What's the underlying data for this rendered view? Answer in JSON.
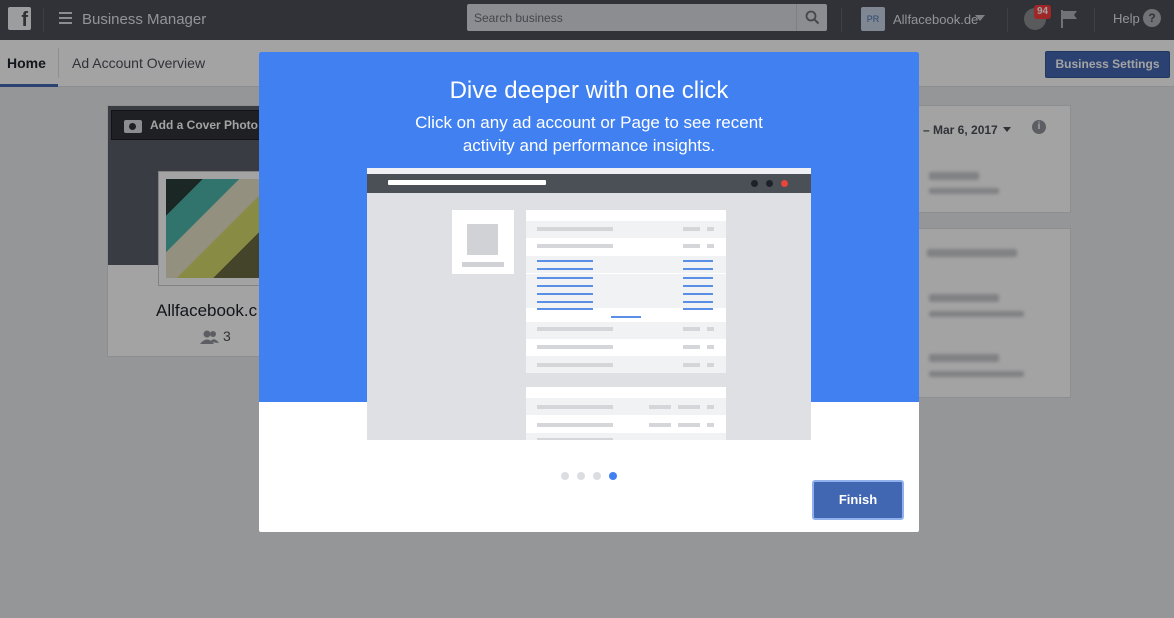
{
  "topbar": {
    "app_title": "Business Manager",
    "search_placeholder": "Search business",
    "account_initials": "PR",
    "account_name": "Allfacebook.de",
    "notification_count": "94",
    "help_label": "Help",
    "help_icon_glyph": "?"
  },
  "subnav": {
    "tabs": [
      {
        "label": "Home",
        "active": true
      },
      {
        "label": "Ad Account Overview",
        "active": false
      }
    ],
    "settings_button": "Business Settings"
  },
  "background": {
    "cover_button": "Add a Cover Photo",
    "page_name": "Allfacebook.c",
    "member_count": "3",
    "date_range": "– Mar 6, 2017",
    "info_icon_glyph": "i"
  },
  "modal": {
    "title": "Dive deeper with one click",
    "subtitle": "Click on any ad account or Page to see recent activity and performance insights.",
    "pager": {
      "total": 4,
      "current": 4
    },
    "finish_button": "Finish"
  },
  "colors": {
    "topbar": "#4b4f56",
    "hero": "#4080f0",
    "primary_button": "#4267b2",
    "badge": "#fa3e3e"
  },
  "icons": [
    "facebook-logo-icon",
    "menu-icon",
    "search-icon",
    "caret-down-icon",
    "notifications-icon",
    "flag-icon",
    "help-icon",
    "camera-icon",
    "members-icon",
    "info-icon"
  ]
}
